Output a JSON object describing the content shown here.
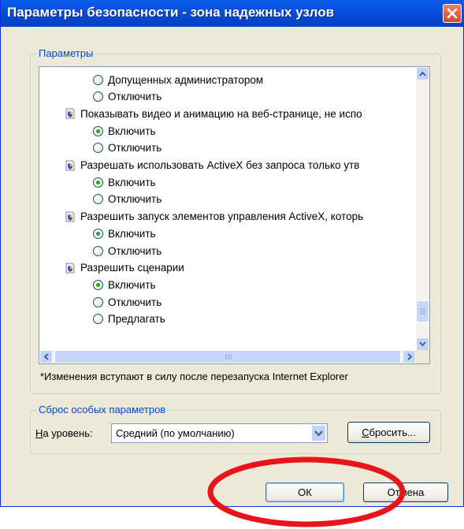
{
  "window": {
    "title": "Параметры безопасности - зона надежных узлов"
  },
  "settings_group": {
    "label": "Параметры",
    "rows": [
      {
        "kind": "radio",
        "label": "Допущенных администратором",
        "checked": false
      },
      {
        "kind": "radio",
        "label": "Отключить",
        "checked": false
      },
      {
        "kind": "setting",
        "label": "Показывать видео и анимацию на веб-странице, не испо"
      },
      {
        "kind": "radio",
        "label": "Включить",
        "checked": true
      },
      {
        "kind": "radio",
        "label": "Отключить",
        "checked": false
      },
      {
        "kind": "setting",
        "label": "Разрешать использовать ActiveX без запроса только утв"
      },
      {
        "kind": "radio",
        "label": "Включить",
        "checked": true
      },
      {
        "kind": "radio",
        "label": "Отключить",
        "checked": false
      },
      {
        "kind": "setting",
        "label": "Разрешить запуск элементов управления ActiveX, которь"
      },
      {
        "kind": "radio",
        "label": "Включить",
        "checked": true
      },
      {
        "kind": "radio",
        "label": "Отключить",
        "checked": false
      },
      {
        "kind": "setting",
        "label": "Разрешить сценарии"
      },
      {
        "kind": "radio",
        "label": "Включить",
        "checked": true
      },
      {
        "kind": "radio",
        "label": "Отключить",
        "checked": false
      },
      {
        "kind": "radio",
        "label": "Предлагать",
        "checked": false
      }
    ],
    "note": "*Изменения вступают в силу после перезапуска Internet Explorer"
  },
  "reset_group": {
    "label": "Сброс особых параметров",
    "level_label_hotkey": "Н",
    "level_label_rest": "а уровень:",
    "level_value": "Средний (по умолчанию)",
    "reset_hotkey": "С",
    "reset_rest": "бросить..."
  },
  "buttons": {
    "ok": "ОК",
    "cancel": "Отмена"
  },
  "colors": {
    "title_bar": "#0a52e0",
    "annotation_circle": "#e8141a"
  }
}
